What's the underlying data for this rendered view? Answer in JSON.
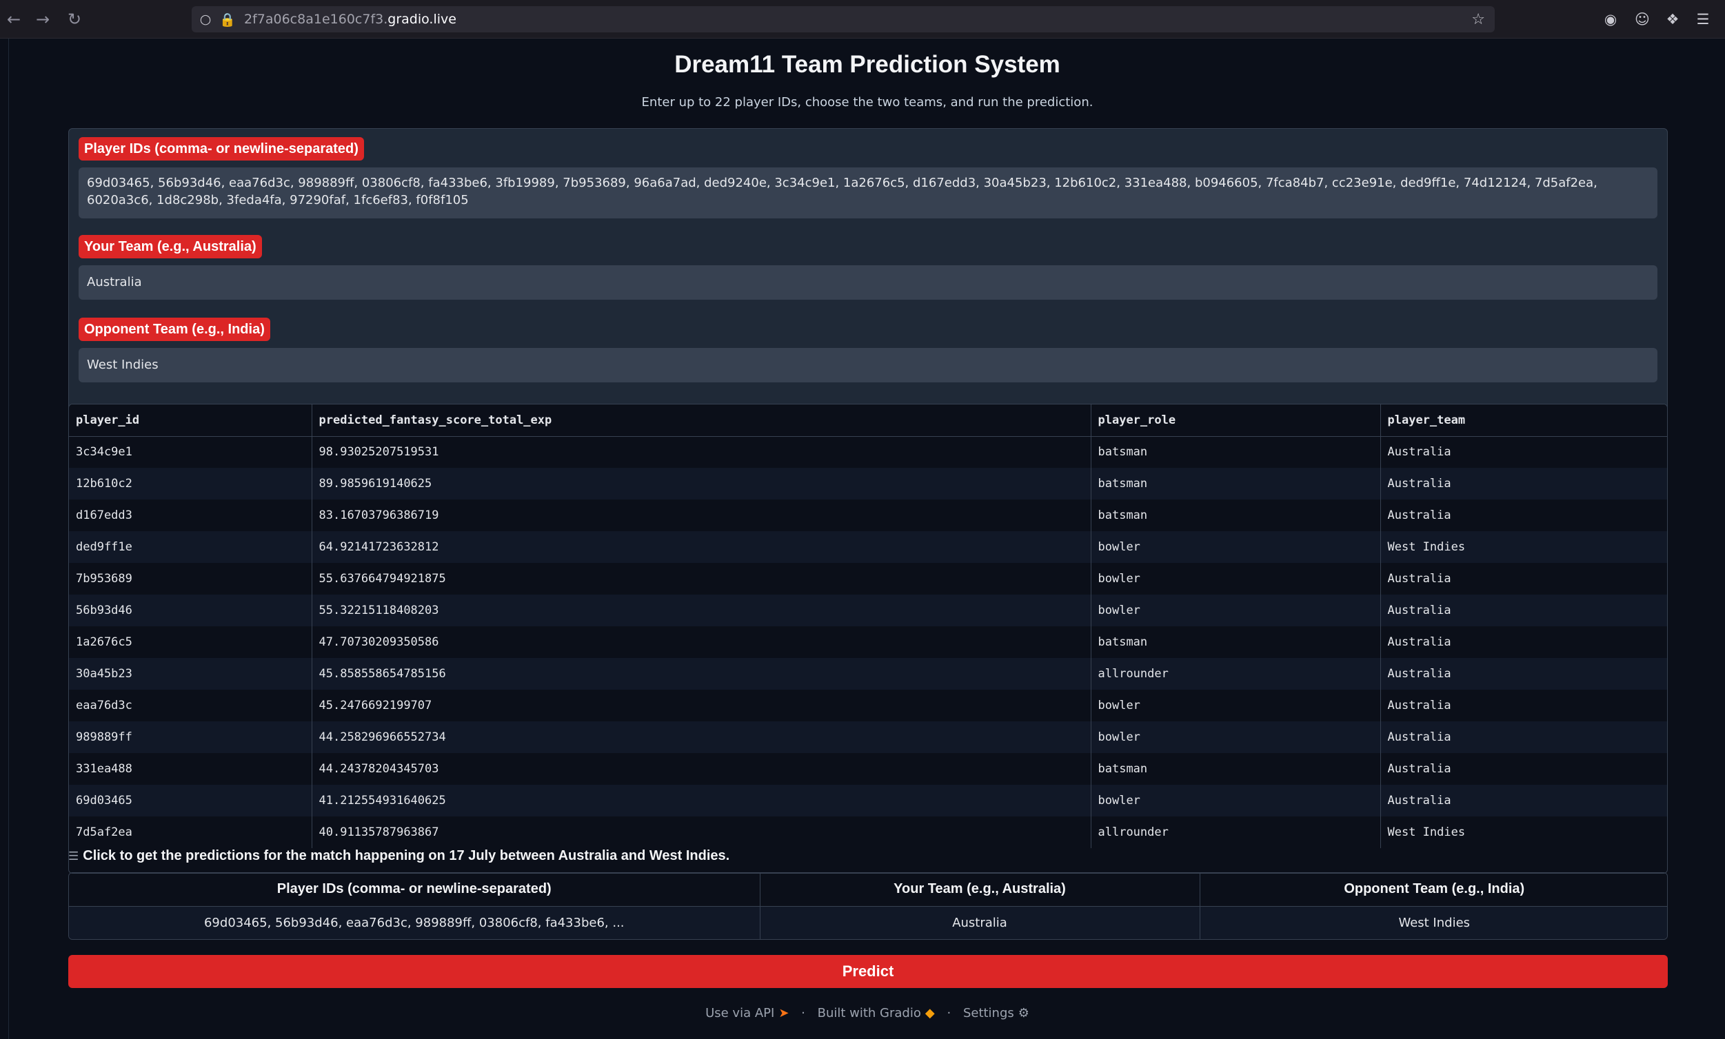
{
  "browser": {
    "url_prefix": "2f7a06c8a1e160c7f3.",
    "url_domain": "gradio.live"
  },
  "page": {
    "title": "Dream11 Team Prediction System",
    "subtitle": "Enter up to 22 player IDs, choose the two teams, and run the prediction."
  },
  "form": {
    "player_ids_label": "Player IDs (comma- or newline-separated)",
    "player_ids_value": "69d03465, 56b93d46, eaa76d3c, 989889ff, 03806cf8, fa433be6, 3fb19989, 7b953689, 96a6a7ad, ded9240e, 3c34c9e1, 1a2676c5, d167edd3, 30a45b23, 12b610c2, 331ea488, b0946605, 7fca84b7, cc23e91e, ded9ff1e, 74d12124, 7d5af2ea, 6020a3c6, 1d8c298b, 3feda4fa, 97290faf, 1fc6ef83, f0f8f105",
    "your_team_label": "Your Team (e.g., Australia)",
    "your_team_value": "Australia",
    "opponent_label": "Opponent Team (e.g., India)",
    "opponent_value": "West Indies"
  },
  "results": {
    "columns": [
      "player_id",
      "predicted_fantasy_score_total_exp",
      "player_role",
      "player_team"
    ],
    "rows": [
      [
        "3c34c9e1",
        "98.93025207519531",
        "batsman",
        "Australia"
      ],
      [
        "12b610c2",
        "89.9859619140625",
        "batsman",
        "Australia"
      ],
      [
        "d167edd3",
        "83.16703796386719",
        "batsman",
        "Australia"
      ],
      [
        "ded9ff1e",
        "64.92141723632812",
        "bowler",
        "West Indies"
      ],
      [
        "7b953689",
        "55.637664794921875",
        "bowler",
        "Australia"
      ],
      [
        "56b93d46",
        "55.32215118408203",
        "bowler",
        "Australia"
      ],
      [
        "1a2676c5",
        "47.70730209350586",
        "batsman",
        "Australia"
      ],
      [
        "30a45b23",
        "45.858558654785156",
        "allrounder",
        "Australia"
      ],
      [
        "eaa76d3c",
        "45.2476692199707",
        "bowler",
        "Australia"
      ],
      [
        "989889ff",
        "44.258296966552734",
        "bowler",
        "Australia"
      ],
      [
        "331ea488",
        "44.24378204345703",
        "batsman",
        "Australia"
      ],
      [
        "69d03465",
        "41.212554931640625",
        "bowler",
        "Australia"
      ],
      [
        "7d5af2ea",
        "40.91135787963867",
        "allrounder",
        "West Indies"
      ]
    ]
  },
  "examples": {
    "header": "Click to get the predictions for the match happening on 17 July between Australia and West Indies.",
    "columns": [
      "Player IDs (comma- or newline-separated)",
      "Your Team (e.g., Australia)",
      "Opponent Team (e.g., India)"
    ],
    "row": [
      "69d03465, 56b93d46, eaa76d3c, 989889ff, 03806cf8, fa433be6, ...",
      "Australia",
      "West Indies"
    ]
  },
  "predict_label": "Predict",
  "footer": {
    "api": "Use via API",
    "built": "Built with Gradio",
    "settings": "Settings"
  },
  "colors": {
    "accent": "#dc2626",
    "background": "#0b0f19",
    "panel": "#1f2937",
    "input": "#374151"
  }
}
